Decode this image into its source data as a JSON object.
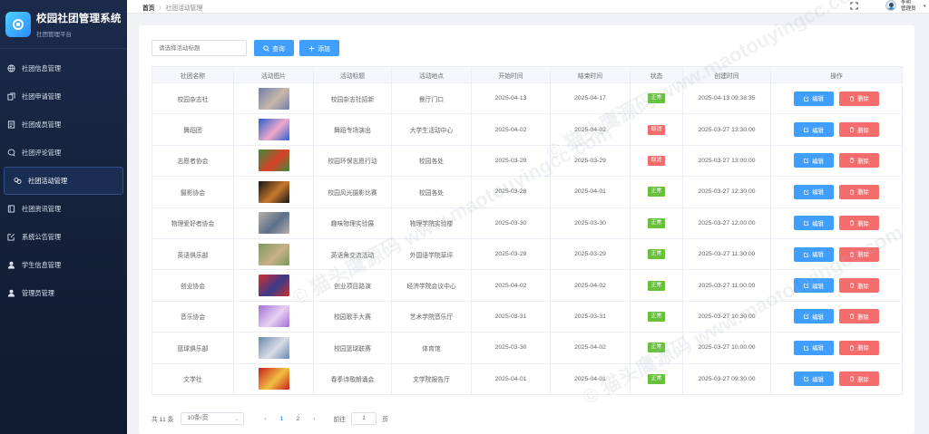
{
  "brand": {
    "title": "校园社团管理系统",
    "subtitle": "社团管理平台"
  },
  "sidebar": {
    "items": [
      {
        "label": "社团信息管理",
        "icon": "globe-icon"
      },
      {
        "label": "社团申请管理",
        "icon": "copy-icon"
      },
      {
        "label": "社团成员管理",
        "icon": "document-icon"
      },
      {
        "label": "社团评论管理",
        "icon": "chat-icon"
      },
      {
        "label": "社团活动管理",
        "icon": "link-icon",
        "active": true
      },
      {
        "label": "社团资讯管理",
        "icon": "notebook-icon"
      },
      {
        "label": "系统公告管理",
        "icon": "edit-icon"
      },
      {
        "label": "学生信息管理",
        "icon": "user-icon"
      },
      {
        "label": "管理员管理",
        "icon": "user-icon"
      }
    ]
  },
  "topbar": {
    "breadcrumb_home": "首页",
    "breadcrumb_sep": "/",
    "breadcrumb_current": "社团活动管理",
    "user_name": "李明",
    "user_role": "管理员"
  },
  "toolbar": {
    "search_placeholder": "请选择活动标题",
    "query_label": "查询",
    "add_label": "添加"
  },
  "table": {
    "headers": [
      "社团名称",
      "活动图片",
      "活动标题",
      "活动地点",
      "开始时间",
      "结束时间",
      "状态",
      "创建时间",
      "操作"
    ],
    "edit_label": "编辑",
    "delete_label": "删除",
    "rows": [
      {
        "club": "校园杂志社",
        "title": "校园杂志社招新",
        "place": "餐厅门口",
        "start": "2025-04-13",
        "end": "2025-04-17",
        "status": "正常",
        "status_ok": true,
        "created": "2025-04-13 09:38:35",
        "img": [
          "#6d7fb0",
          "#c9b7a8"
        ]
      },
      {
        "club": "舞蹈团",
        "title": "舞蹈专场演出",
        "place": "大学生活动中心",
        "start": "2025-04-02",
        "end": "2025-04-02",
        "status": "取消",
        "status_ok": false,
        "created": "2025-03-27 13:30:00",
        "img": [
          "#2a5fd0",
          "#f0a8c8"
        ]
      },
      {
        "club": "志愿者协会",
        "title": "校园环保志愿行动",
        "place": "校园各处",
        "start": "2025-03-29",
        "end": "2025-03-29",
        "status": "取消",
        "status_ok": false,
        "created": "2025-03-27 13:00:00",
        "img": [
          "#3e8a3a",
          "#d8402a"
        ]
      },
      {
        "club": "摄影协会",
        "title": "校园风光摄影比赛",
        "place": "校园各处",
        "start": "2025-03-28",
        "end": "2025-04-01",
        "status": "正常",
        "status_ok": true,
        "created": "2025-03-27 12:30:00",
        "img": [
          "#141414",
          "#c9782c"
        ]
      },
      {
        "club": "物理爱好者协会",
        "title": "趣味物理实验展",
        "place": "物理学院实验楼",
        "start": "2025-03-30",
        "end": "2025-03-30",
        "status": "正常",
        "status_ok": true,
        "created": "2025-03-27 12:00:00",
        "img": [
          "#b8b0a6",
          "#5a6f8a"
        ]
      },
      {
        "club": "英语俱乐部",
        "title": "英语角交流活动",
        "place": "外国语学院草坪",
        "start": "2025-03-29",
        "end": "2025-03-29",
        "status": "正常",
        "status_ok": true,
        "created": "2025-03-27 11:30:00",
        "img": [
          "#7a9a5a",
          "#c8b08a"
        ]
      },
      {
        "club": "创业协会",
        "title": "创业项目路演",
        "place": "经济学院会议中心",
        "start": "2025-04-02",
        "end": "2025-04-02",
        "status": "正常",
        "status_ok": true,
        "created": "2025-03-27 11:00:00",
        "img": [
          "#d03030",
          "#3a3a8a"
        ]
      },
      {
        "club": "音乐协会",
        "title": "校园歌手大赛",
        "place": "艺术学院音乐厅",
        "start": "2025-03-31",
        "end": "2025-03-31",
        "status": "正常",
        "status_ok": true,
        "created": "2025-03-27 10:30:00",
        "img": [
          "#a070d8",
          "#e8d0f0"
        ]
      },
      {
        "club": "篮球俱乐部",
        "title": "校园篮球联赛",
        "place": "体育馆",
        "start": "2025-03-30",
        "end": "2025-04-02",
        "status": "正常",
        "status_ok": true,
        "created": "2025-03-27 10:00:00",
        "img": [
          "#6a86b0",
          "#d8dce6"
        ]
      },
      {
        "club": "文学社",
        "title": "春季诗歌朗诵会",
        "place": "文学院报告厅",
        "start": "2025-04-01",
        "end": "2025-04-01",
        "status": "正常",
        "status_ok": true,
        "created": "2025-03-27 09:30:00",
        "img": [
          "#c81e1e",
          "#f0c040"
        ]
      }
    ]
  },
  "pagination": {
    "total": "共 11 条",
    "page_size": "10条/页",
    "pages": [
      "1",
      "2"
    ],
    "current": "1",
    "goto_prefix": "前往",
    "goto_value": "1",
    "goto_suffix": "页"
  },
  "colors": {
    "primary": "#409eff",
    "success": "#67c23a",
    "danger": "#f56c6c",
    "sidebar": "#15223c"
  }
}
